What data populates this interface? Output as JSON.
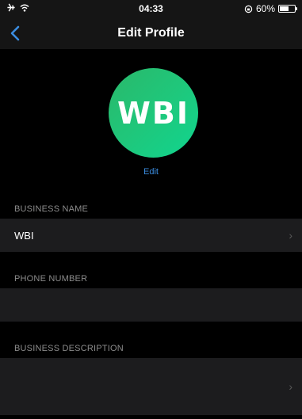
{
  "status_bar": {
    "time": "04:33",
    "battery_percent": "60%",
    "battery_level": 0.6
  },
  "nav": {
    "title": "Edit Profile",
    "back_icon": "chevron-left-icon"
  },
  "profile": {
    "avatar_text": "WBI",
    "edit_label": "Edit"
  },
  "sections": {
    "business_name": {
      "label": "BUSINESS NAME",
      "value": "WBI"
    },
    "phone_number": {
      "label": "PHONE NUMBER",
      "value": ""
    },
    "business_description": {
      "label": "BUSINESS DESCRIPTION",
      "value": ""
    }
  },
  "colors": {
    "accent": "#3b8de0",
    "avatar_start": "#2ab86a",
    "avatar_end": "#10d58f",
    "row_bg": "#1c1c1e"
  }
}
